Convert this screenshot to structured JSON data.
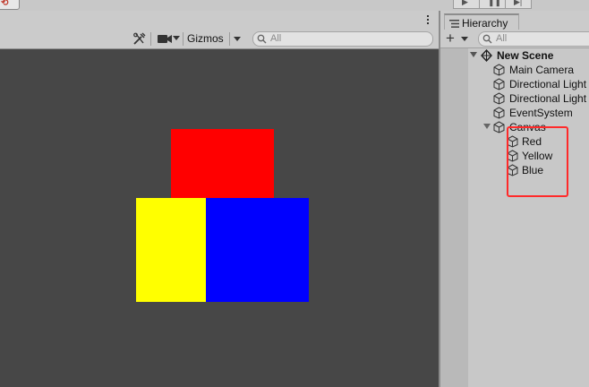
{
  "scene_view": {
    "toolbar": {
      "tools_icon": "tools-icon",
      "camera_icon": "camera-icon",
      "gizmos_label": "Gizmos",
      "search_placeholder": "All"
    },
    "canvas_elements": [
      {
        "name": "Red",
        "color": "#ff0000"
      },
      {
        "name": "Yellow",
        "color": "#ffff00"
      },
      {
        "name": "Blue",
        "color": "#0000ff"
      }
    ],
    "background_color": "#474747"
  },
  "hierarchy": {
    "tab_label": "Hierarchy",
    "add_icon": "plus-icon",
    "search_placeholder": "All",
    "scene_name": "New Scene",
    "items": [
      {
        "label": "Main Camera"
      },
      {
        "label": "Directional Light"
      },
      {
        "label": "Directional Light"
      },
      {
        "label": "EventSystem"
      },
      {
        "label": "Canvas",
        "expanded": true,
        "children": [
          {
            "label": "Red"
          },
          {
            "label": "Yellow"
          },
          {
            "label": "Blue"
          }
        ]
      }
    ],
    "highlight_color": "#ff2a2a"
  }
}
